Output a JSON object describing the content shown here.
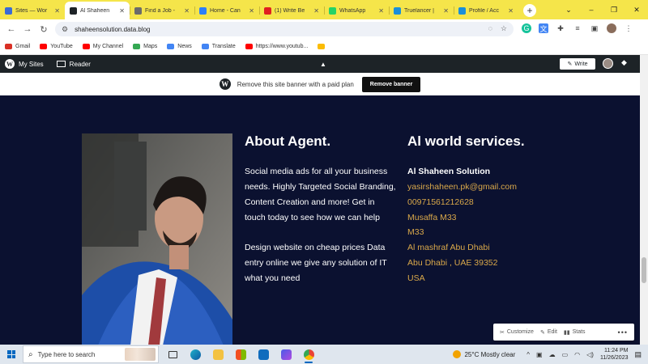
{
  "browser": {
    "tabs": [
      {
        "title": "Sites — Wor",
        "color": "#3a6bd6",
        "active": false
      },
      {
        "title": "Al Shaheen",
        "color": "#1d2327",
        "active": true
      },
      {
        "title": "Find a Job -",
        "color": "#6b6b6b",
        "active": false
      },
      {
        "title": "Home - Can",
        "color": "#2d7ff9",
        "active": false
      },
      {
        "title": "(1) Write Be",
        "color": "#e02020",
        "active": false
      },
      {
        "title": "WhatsApp",
        "color": "#25d366",
        "active": false
      },
      {
        "title": "Truelancer |",
        "color": "#1a8fd9",
        "active": false
      },
      {
        "title": "Profile / Acc",
        "color": "#1a8fd9",
        "active": false
      }
    ],
    "new_tab": "+",
    "window_controls": [
      "⌄",
      "–",
      "❐",
      "✕"
    ],
    "url": "shaheensolution.data.blog",
    "bookmarks": [
      {
        "label": "Gmail",
        "color": "#d93025"
      },
      {
        "label": "YouTube",
        "color": "#ff0000"
      },
      {
        "label": "My Channel",
        "color": "#ff0000"
      },
      {
        "label": "Maps",
        "color": "#34a853"
      },
      {
        "label": "News",
        "color": "#4285f4"
      },
      {
        "label": "Translate",
        "color": "#4285f4"
      },
      {
        "label": "https://www.youtub...",
        "color": "#ff0000"
      },
      {
        "label": "",
        "color": "#fbbc04"
      }
    ]
  },
  "wp_admin": {
    "my_sites": "My Sites",
    "reader": "Reader",
    "write": "Write"
  },
  "banner": {
    "text": "Remove this site banner with a paid plan",
    "button": "Remove banner"
  },
  "about": {
    "heading": "About Agent.",
    "para1_lines": [
      "Social media ads for all your business",
      "needs. Highly Targeted Social Branding,",
      "Content Creation and more! Get in",
      "touch today to see how we can help"
    ],
    "para2_lines": [
      "Design website on cheap prices Data",
      "entry online we give any solution of IT",
      "what you need"
    ]
  },
  "services": {
    "heading": "Al world services.",
    "company": "Al Shaheen Solution",
    "email": "yasirshaheen.pk@gmail.com",
    "phone": "00971561212628",
    "address1": "Musaffa M33",
    "address2": "M33",
    "address3": "Al mashraf Abu Dhabi",
    "address4": "Abu Dhabi , UAE 39352",
    "country": "USA",
    "link_color": "#d9a84a"
  },
  "wp_toolbar": {
    "customize": "Customize",
    "edit": "Edit",
    "stats": "Stats",
    "more": "•••"
  },
  "taskbar": {
    "search_placeholder": "Type here to search",
    "weather": "25°C  Mostly clear",
    "time": "11:24 PM",
    "date": "11/26/2023"
  }
}
